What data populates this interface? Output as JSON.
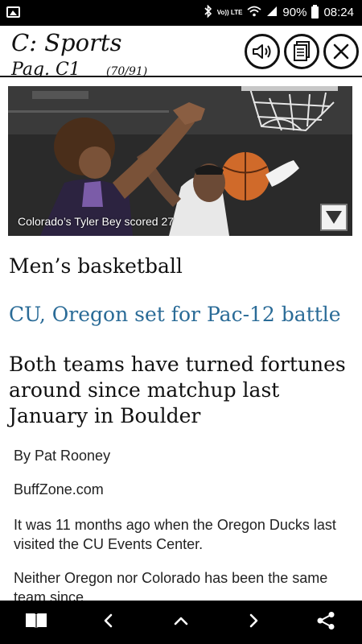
{
  "status_bar": {
    "volte_label": "Vo)) LTE",
    "battery_text": "90%",
    "time": "08:24"
  },
  "header": {
    "section_title": "C: Sports",
    "page_label": "Pag. C1",
    "page_count": "(70/91)"
  },
  "photo": {
    "caption": "Colorado’s Tyler Bey scored 27"
  },
  "article": {
    "kicker": "Men’s basketball",
    "headline": "CU, Oregon set for Pac-12 battle",
    "deck": "Both teams have turned fortunes around since matchup last January in Boulder",
    "byline": "By Pat Rooney",
    "source": "BuffZone.com",
    "paragraph_1": "It was 11 months ago when the Oregon Ducks last visited the CU Events Center.",
    "paragraph_2": "Neither Oregon nor Colorado has been the same team since."
  },
  "colors": {
    "headline": "#2a6b97",
    "bars": "#000000"
  },
  "icons": {
    "speaker": "speaker-icon",
    "text_view": "document-icon",
    "close": "close-icon",
    "library": "open-book-icon",
    "previous": "chevron-left-icon",
    "up": "chevron-up-icon",
    "next": "chevron-right-icon",
    "share": "share-icon"
  }
}
